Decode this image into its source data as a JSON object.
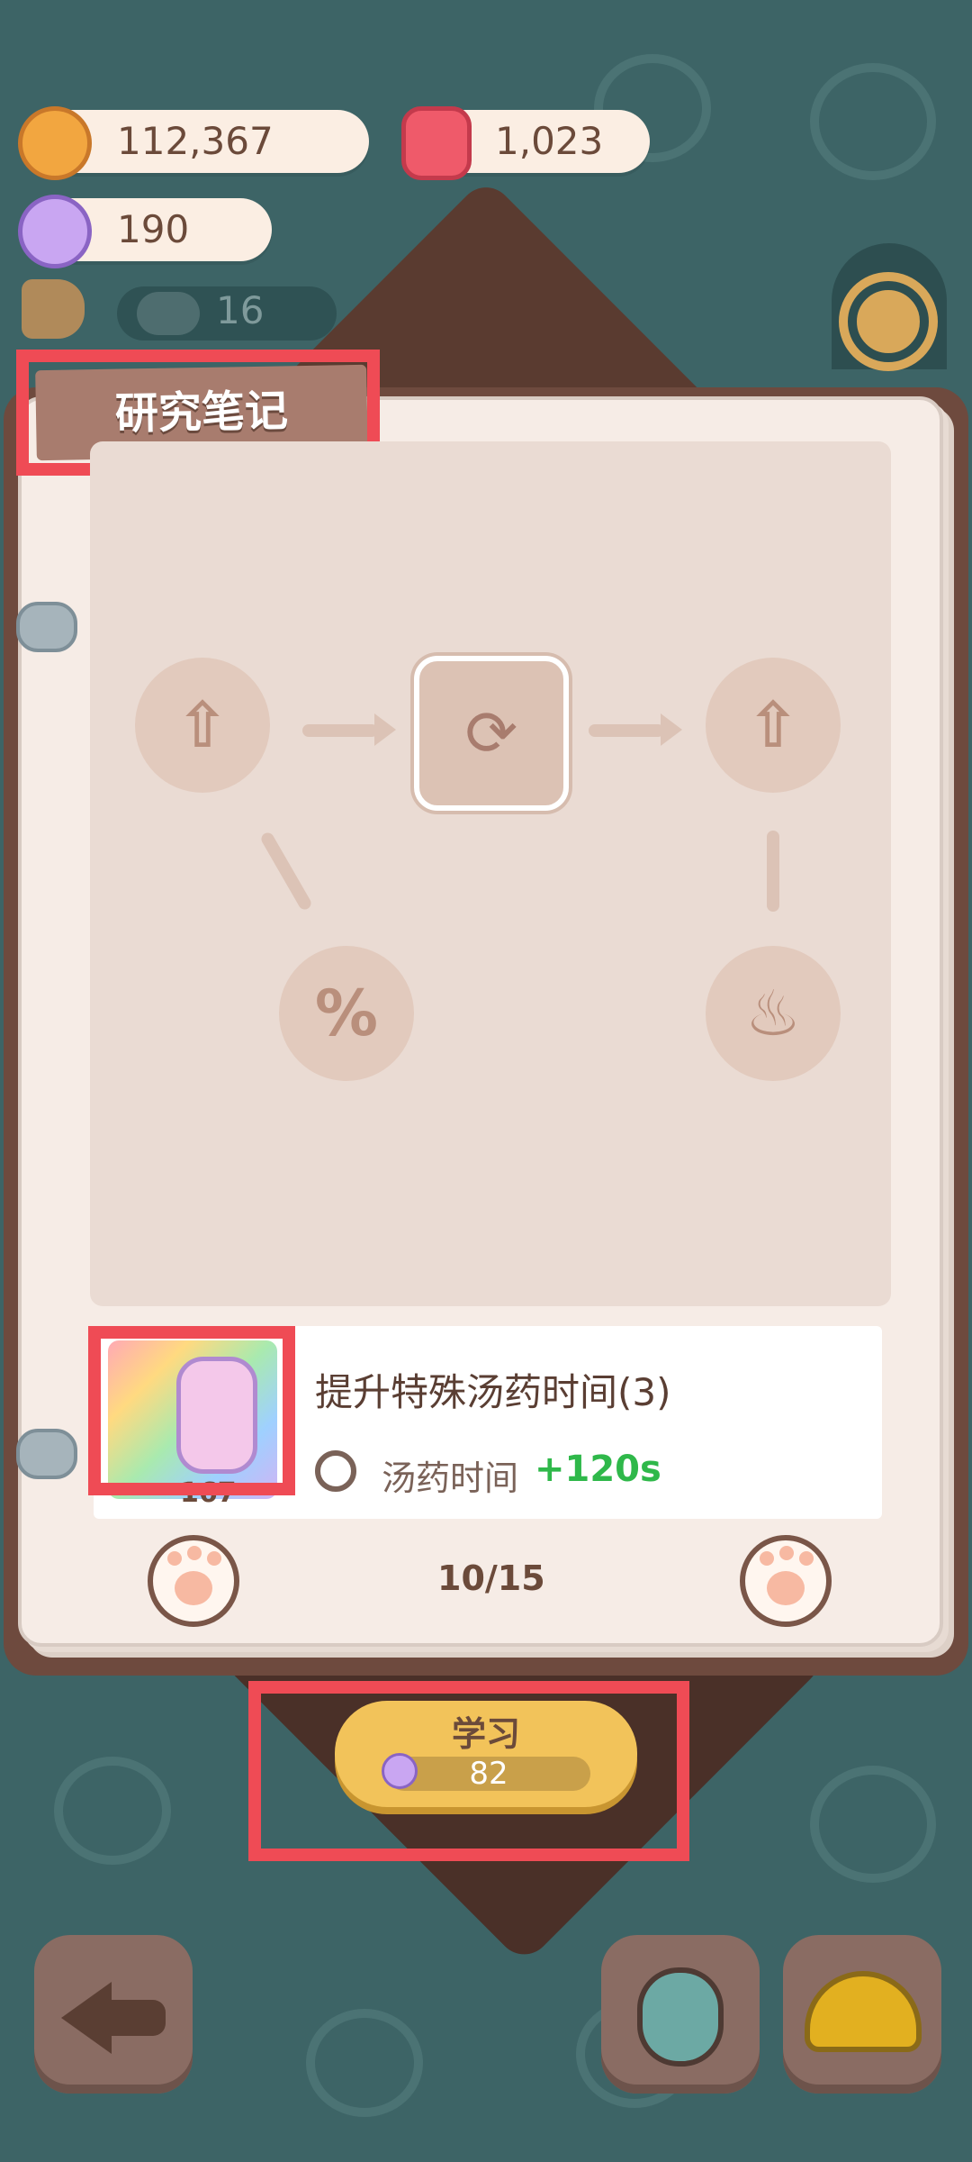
{
  "currencies": {
    "cookies": "112,367",
    "gems": "1,023",
    "candy": "190",
    "visitors": "16"
  },
  "notebook": {
    "title": "研究笔记",
    "page_indicator": "10/15"
  },
  "research_item": {
    "title": "提升特殊汤药时间(3)",
    "effect_label": "汤药时间",
    "effect_value": "+120s",
    "item_count": "167"
  },
  "learn_button": {
    "label": "学习",
    "cost": "82"
  },
  "colors": {
    "background": "#3d6466",
    "highlight": "#ef4b55",
    "accent_green": "#2fb84a",
    "button_yellow": "#f2c35a"
  },
  "icons": {
    "currency_1": "cookie-icon",
    "currency_2": "jelly-gem-icon",
    "currency_3": "candy-icon",
    "visitors": "megaphone-icon",
    "settings": "gear-icon",
    "back": "arrow-left-icon",
    "potion": "potion-bottle-icon",
    "helmet": "helmet-icon"
  }
}
